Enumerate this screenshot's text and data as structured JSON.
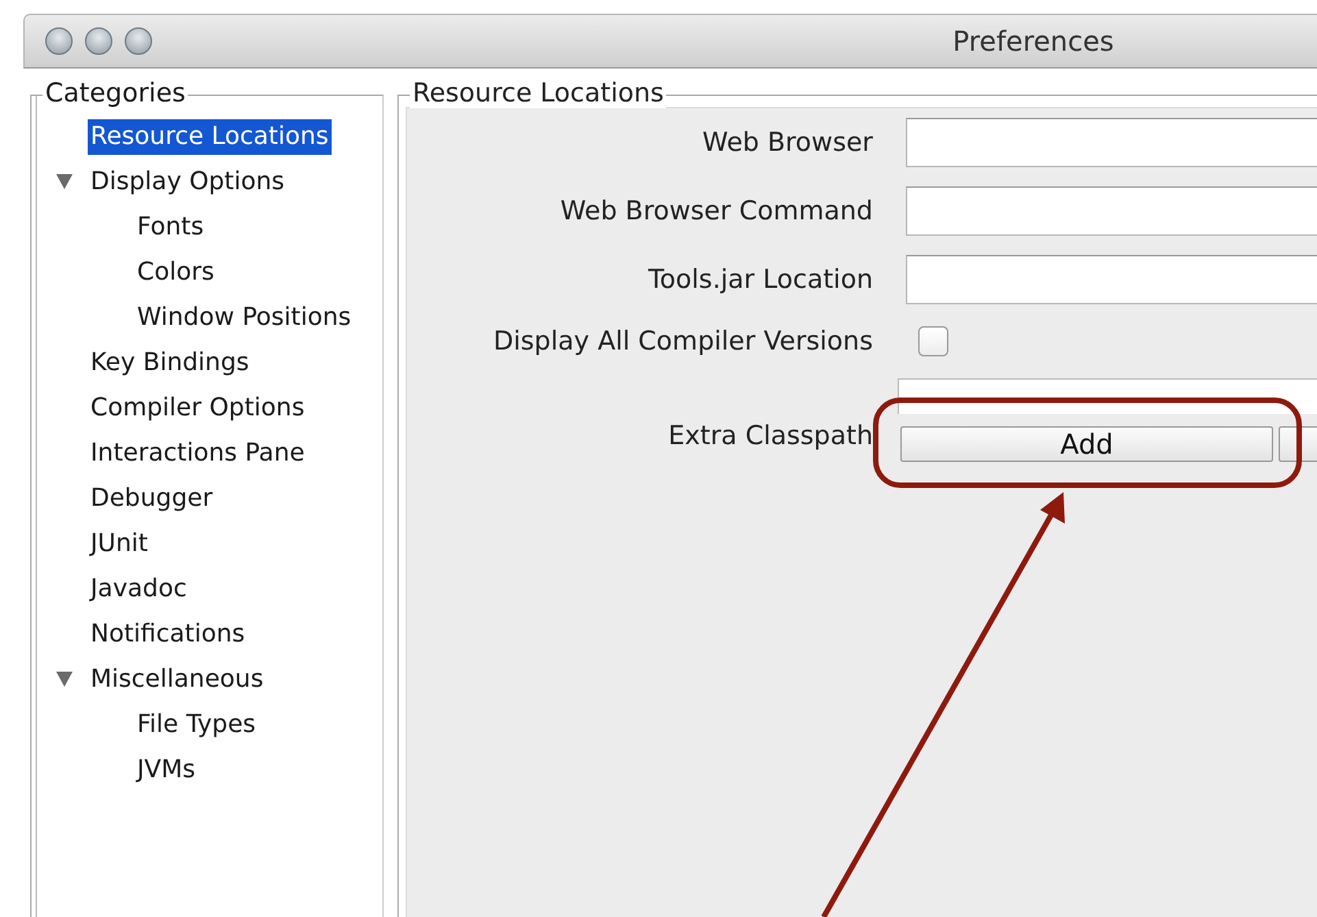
{
  "window": {
    "title": "Preferences"
  },
  "categories": {
    "title": "Categories",
    "items": [
      {
        "label": "Resource Locations",
        "selected": true
      },
      {
        "label": "Display Options",
        "selected": false,
        "expanded": true,
        "children": [
          {
            "label": "Fonts",
            "selected": false
          },
          {
            "label": "Colors",
            "selected": false
          },
          {
            "label": "Window Positions",
            "selected": false
          }
        ]
      },
      {
        "label": "Key Bindings",
        "selected": false
      },
      {
        "label": "Compiler Options",
        "selected": false
      },
      {
        "label": "Interactions Pane",
        "selected": false
      },
      {
        "label": "Debugger",
        "selected": false
      },
      {
        "label": "JUnit",
        "selected": false
      },
      {
        "label": "Javadoc",
        "selected": false
      },
      {
        "label": "Notifications",
        "selected": false
      },
      {
        "label": "Miscellaneous",
        "selected": false,
        "expanded": true,
        "children": [
          {
            "label": "File Types",
            "selected": false
          },
          {
            "label": "JVMs",
            "selected": false
          }
        ]
      }
    ]
  },
  "panel": {
    "title": "Resource Locations",
    "rows": [
      {
        "kind": "text",
        "label": "Web Browser"
      },
      {
        "kind": "text",
        "label": "Web Browser Command"
      },
      {
        "kind": "text",
        "label": "Tools.jar Location"
      },
      {
        "kind": "checkbox",
        "label": "Display All Compiler Versions",
        "checked": false
      },
      {
        "kind": "list",
        "label": "Extra Classpath",
        "buttons": [
          "Add"
        ]
      }
    ]
  }
}
